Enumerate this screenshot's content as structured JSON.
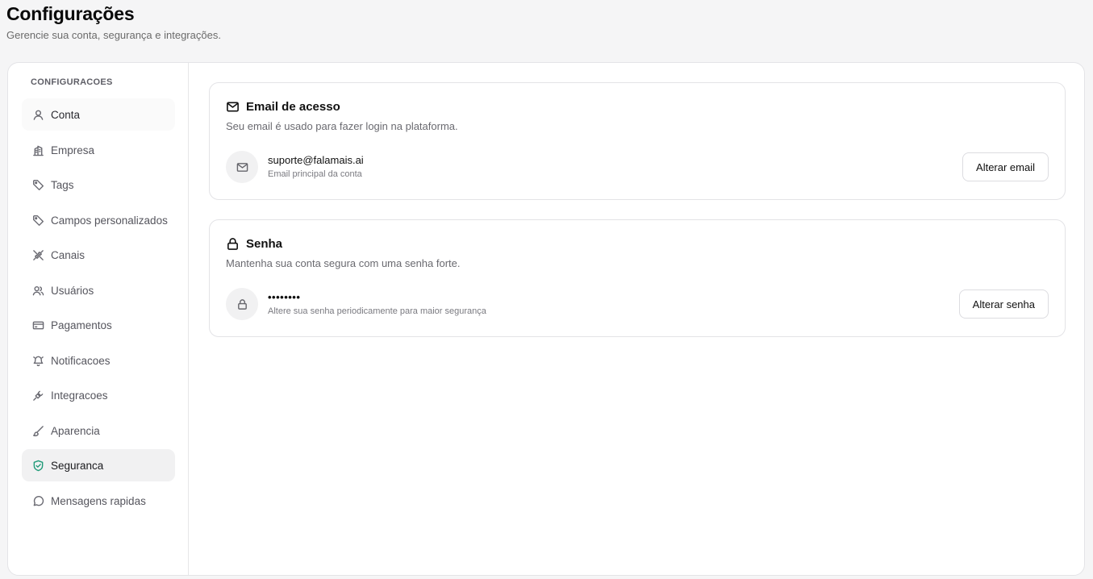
{
  "header": {
    "title": "Configurações",
    "subtitle": "Gerencie sua conta, segurança e integrações."
  },
  "sidebar": {
    "heading": "CONFIGURACOES",
    "items": [
      {
        "label": "Conta",
        "icon": "user-icon"
      },
      {
        "label": "Empresa",
        "icon": "building-icon"
      },
      {
        "label": "Tags",
        "icon": "tag-icon"
      },
      {
        "label": "Campos personalizados",
        "icon": "tag-icon"
      },
      {
        "label": "Canais",
        "icon": "unplug-icon"
      },
      {
        "label": "Usuários",
        "icon": "users-icon"
      },
      {
        "label": "Pagamentos",
        "icon": "credit-card-icon"
      },
      {
        "label": "Notificacoes",
        "icon": "bell-icon"
      },
      {
        "label": "Integracoes",
        "icon": "plug-icon"
      },
      {
        "label": "Aparencia",
        "icon": "brush-icon"
      },
      {
        "label": "Seguranca",
        "icon": "shield-check-icon",
        "active": true
      },
      {
        "label": "Mensagens rapidas",
        "icon": "message-circle-icon"
      }
    ]
  },
  "email_card": {
    "title": "Email de acesso",
    "description": "Seu email é usado para fazer login na plataforma.",
    "value": "suporte@falamais.ai",
    "caption": "Email principal da conta",
    "button": "Alterar email"
  },
  "password_card": {
    "title": "Senha",
    "description": "Mantenha sua conta segura com uma senha forte.",
    "value": "••••••••",
    "caption": "Altere sua senha periodicamente para maior segurança",
    "button": "Alterar senha"
  },
  "colors": {
    "active_icon": "#1f9a78",
    "border": "#e4e4e7"
  }
}
